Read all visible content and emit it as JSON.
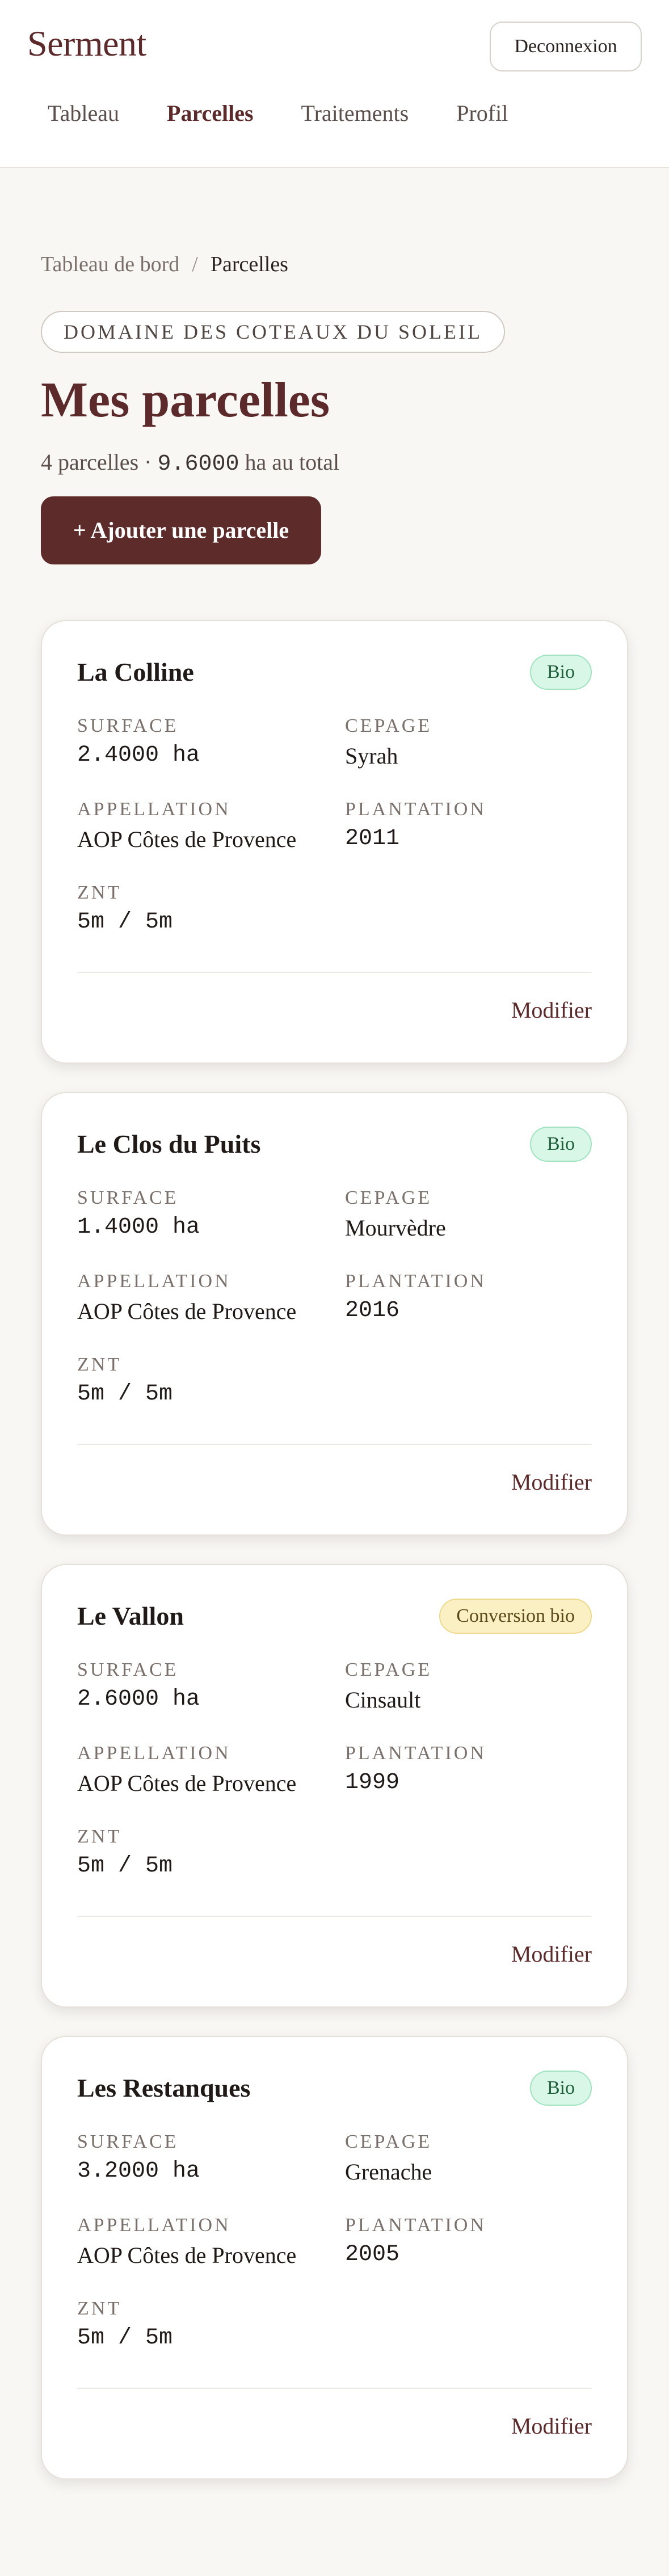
{
  "header": {
    "brand": "Serment",
    "logout_label": "Deconnexion",
    "nav": [
      {
        "label": "Tableau",
        "active": false
      },
      {
        "label": "Parcelles",
        "active": true
      },
      {
        "label": "Traitements",
        "active": false
      },
      {
        "label": "Profil",
        "active": false
      }
    ]
  },
  "breadcrumb": {
    "home": "Tableau de bord",
    "separator": "/",
    "current": "Parcelles"
  },
  "domain": "DOMAINE DES COTEAUX DU SOLEIL",
  "page_title": "Mes parcelles",
  "summary": {
    "prefix": "4 parcelles · ",
    "total": "9.6000",
    "suffix": " ha au total"
  },
  "add_button": "+ Ajouter une parcelle",
  "labels": {
    "surface": "SURFACE",
    "cepage": "CEPAGE",
    "appellation": "APPELLATION",
    "plantation": "PLANTATION",
    "znt": "ZNT",
    "edit": "Modifier"
  },
  "colors": {
    "brand": "#5c2a2a",
    "bio_bg": "#d9f7e6",
    "conversion_bg": "#fbf0c4"
  },
  "parcels": [
    {
      "name": "La Colline",
      "badge": "Bio",
      "badge_type": "bio",
      "surface": "2.4000 ha",
      "cepage": "Syrah",
      "appellation": "AOP Côtes de Provence",
      "plantation": "2011",
      "znt": "5m / 5m"
    },
    {
      "name": "Le Clos du Puits",
      "badge": "Bio",
      "badge_type": "bio",
      "surface": "1.4000 ha",
      "cepage": "Mourvèdre",
      "appellation": "AOP Côtes de Provence",
      "plantation": "2016",
      "znt": "5m / 5m"
    },
    {
      "name": "Le Vallon",
      "badge": "Conversion bio",
      "badge_type": "conv",
      "surface": "2.6000 ha",
      "cepage": "Cinsault",
      "appellation": "AOP Côtes de Provence",
      "plantation": "1999",
      "znt": "5m / 5m"
    },
    {
      "name": "Les Restanques",
      "badge": "Bio",
      "badge_type": "bio",
      "surface": "3.2000 ha",
      "cepage": "Grenache",
      "appellation": "AOP Côtes de Provence",
      "plantation": "2005",
      "znt": "5m / 5m"
    }
  ]
}
